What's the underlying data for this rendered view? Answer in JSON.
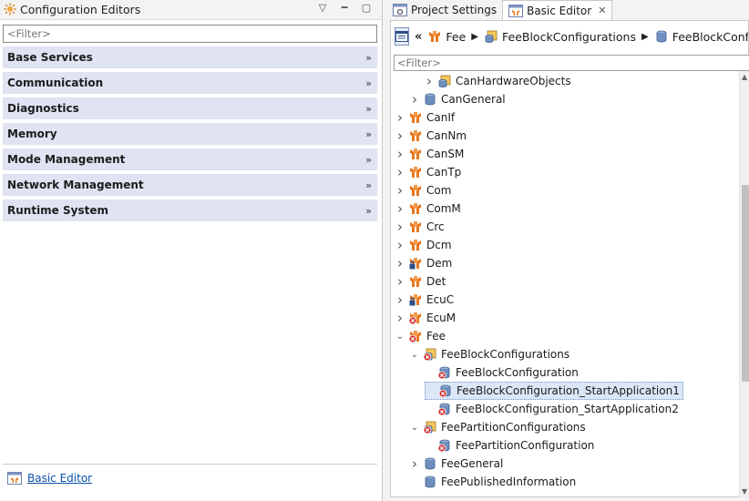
{
  "left": {
    "title": "Configuration Editors",
    "filter_placeholder": "<Filter>",
    "categories": [
      {
        "label": "Base Services"
      },
      {
        "label": "Communication"
      },
      {
        "label": "Diagnostics"
      },
      {
        "label": "Memory"
      },
      {
        "label": "Mode Management"
      },
      {
        "label": "Network Management"
      },
      {
        "label": "Runtime System"
      }
    ],
    "footer_link": "Basic Editor"
  },
  "right": {
    "tabs": [
      {
        "label": "Project Settings"
      },
      {
        "label": "Basic Editor",
        "close": "✕"
      }
    ],
    "breadcrumb": {
      "items": [
        "Fee",
        "FeeBlockConfigurations",
        "FeeBlockConf"
      ]
    },
    "filter_placeholder": "<Filter>",
    "tree": [
      {
        "label": "CanHardwareObjects",
        "icon": "container-package-icon",
        "twisty": "›"
      },
      {
        "label": "CanGeneral",
        "icon": "container-icon",
        "twisty": "›"
      },
      {
        "label": "CanIf",
        "icon": "module-icon",
        "twisty": "›"
      },
      {
        "label": "CanNm",
        "icon": "module-icon",
        "twisty": "›"
      },
      {
        "label": "CanSM",
        "icon": "module-icon",
        "twisty": "›"
      },
      {
        "label": "CanTp",
        "icon": "module-icon",
        "twisty": "›"
      },
      {
        "label": "Com",
        "icon": "module-icon",
        "twisty": "›"
      },
      {
        "label": "ComM",
        "icon": "module-icon",
        "twisty": "›"
      },
      {
        "label": "Crc",
        "icon": "module-icon",
        "twisty": "›"
      },
      {
        "label": "Dcm",
        "icon": "module-icon",
        "twisty": "›"
      },
      {
        "label": "Dem",
        "icon": "module-locked-icon",
        "twisty": "›"
      },
      {
        "label": "Det",
        "icon": "module-icon",
        "twisty": "›"
      },
      {
        "label": "EcuC",
        "icon": "module-locked-icon",
        "twisty": "›"
      },
      {
        "label": "EcuM",
        "icon": "module-error-icon",
        "twisty": "›"
      },
      {
        "label": "Fee",
        "icon": "module-error-icon",
        "twisty": "⌄"
      },
      {
        "label": "FeeBlockConfigurations",
        "icon": "container-package-error-icon",
        "twisty": "⌄"
      },
      {
        "label": "FeeBlockConfiguration",
        "icon": "container-error-icon",
        "twisty": ""
      },
      {
        "label": "FeeBlockConfiguration_StartApplication1",
        "icon": "container-error-icon",
        "twisty": ""
      },
      {
        "label": "FeeBlockConfiguration_StartApplication2",
        "icon": "container-error-icon",
        "twisty": ""
      },
      {
        "label": "FeePartitionConfigurations",
        "icon": "container-package-error-icon",
        "twisty": "⌄"
      },
      {
        "label": "FeePartitionConfiguration",
        "icon": "container-error-icon",
        "twisty": ""
      },
      {
        "label": "FeeGeneral",
        "icon": "container-icon",
        "twisty": "›"
      },
      {
        "label": "FeePublishedInformation",
        "icon": "container-icon",
        "twisty": ""
      }
    ]
  },
  "colors": {
    "category_bg": "#dfe3f2",
    "selection_bg": "#dbe6f7",
    "link": "#0b4fa8",
    "module_orange": "#e8771e"
  }
}
